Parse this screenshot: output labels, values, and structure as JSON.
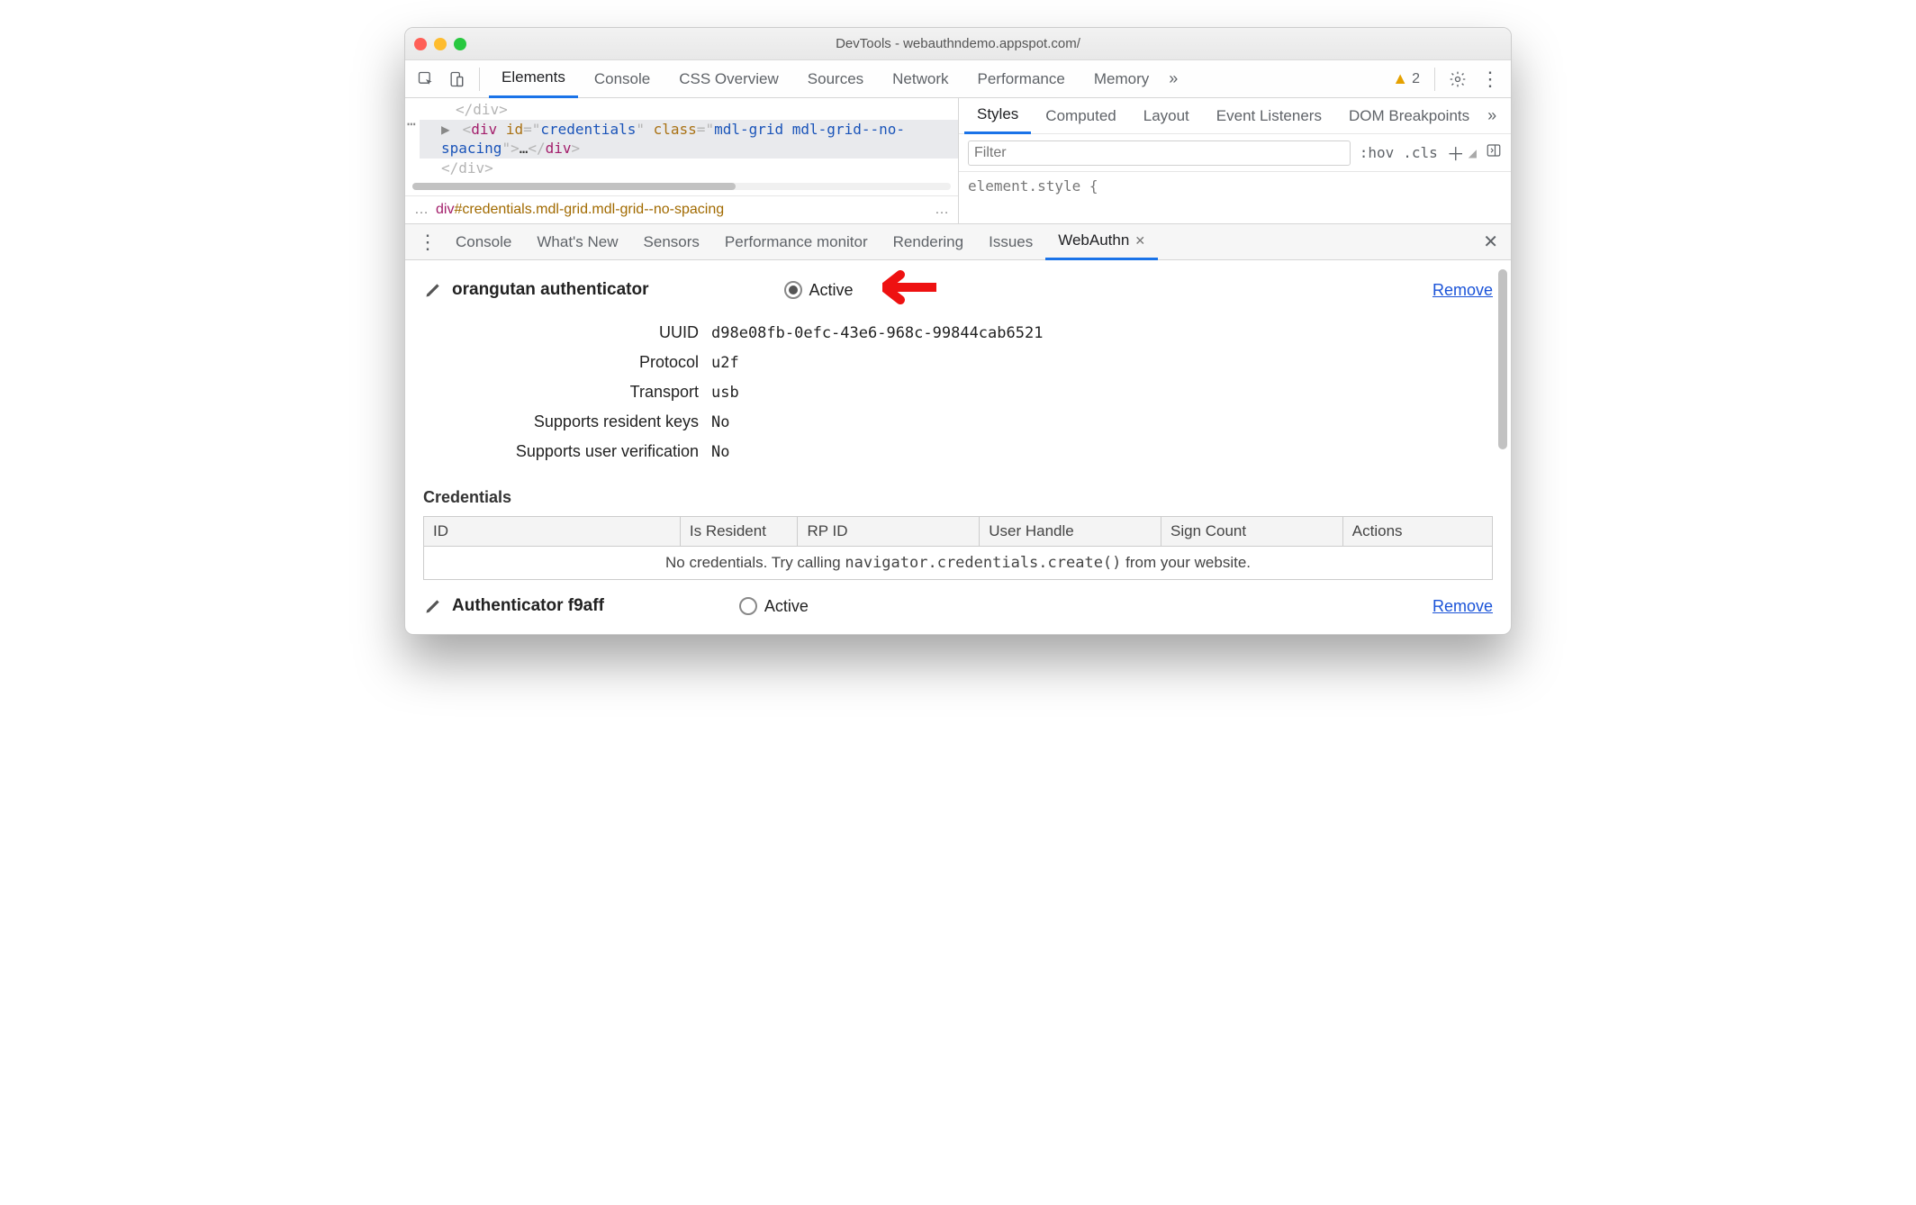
{
  "window": {
    "title": "DevTools - webauthndemo.appspot.com/"
  },
  "top_tabs": {
    "items": [
      "Elements",
      "Console",
      "CSS Overview",
      "Sources",
      "Network",
      "Performance",
      "Memory"
    ],
    "active_index": 0,
    "overflow_glyph": "»",
    "warning_count": "2"
  },
  "elements_code": {
    "line0": "</div>",
    "line1_prefix": "▶",
    "line1_open_tag": "div",
    "line1_id_attr": "id",
    "line1_id_val": "credentials",
    "line1_class_attr": "class",
    "line1_class_val": "mdl-grid mdl-grid--no-spacing",
    "line1_ellipsis": "…",
    "line1_close_tag": "div",
    "line2": "</div>"
  },
  "breadcrumb": {
    "leading": "…",
    "tag": "div",
    "rest": "#credentials.mdl-grid.mdl-grid--no-spacing",
    "trailing": "…"
  },
  "styles_tabs": {
    "items": [
      "Styles",
      "Computed",
      "Layout",
      "Event Listeners",
      "DOM Breakpoints"
    ],
    "active_index": 0,
    "overflow_glyph": "»"
  },
  "styles_filter": {
    "placeholder": "Filter",
    "hov": ":hov",
    "cls": ".cls",
    "element_style": "element.style {"
  },
  "drawer_tabs": {
    "items": [
      "Console",
      "What's New",
      "Sensors",
      "Performance monitor",
      "Rendering",
      "Issues",
      "WebAuthn"
    ],
    "active_index": 6
  },
  "authenticator1": {
    "name": "orangutan authenticator",
    "active_label": "Active",
    "remove_label": "Remove",
    "rows": {
      "uuid_key": "UUID",
      "uuid_val": "d98e08fb-0efc-43e6-968c-99844cab6521",
      "protocol_key": "Protocol",
      "protocol_val": "u2f",
      "transport_key": "Transport",
      "transport_val": "usb",
      "resident_key": "Supports resident keys",
      "resident_val": "No",
      "userver_key": "Supports user verification",
      "userver_val": "No"
    }
  },
  "credentials": {
    "heading": "Credentials",
    "cols": [
      "ID",
      "Is Resident",
      "RP ID",
      "User Handle",
      "Sign Count",
      "Actions"
    ],
    "empty_pre": "No credentials. Try calling ",
    "empty_code": "navigator.credentials.create()",
    "empty_post": " from your website."
  },
  "authenticator2": {
    "name": "Authenticator f9aff",
    "active_label": "Active",
    "remove_label": "Remove"
  }
}
